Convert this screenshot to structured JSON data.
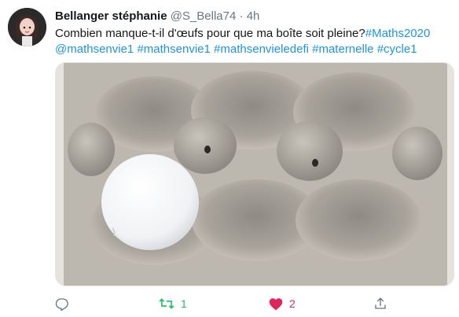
{
  "tweet": {
    "author_name": "Bellanger stéphanie",
    "handle": "@S_Bella74",
    "separator": "·",
    "time": "4h",
    "text_plain": "Combien manque-t-il d'œufs pour que ma boîte soit pleine?",
    "hashtags": [
      "#Maths2020",
      "@mathsenvie1",
      "#mathsenvie1",
      "#mathsenvieledefi",
      "#maternelle",
      "#cycle1"
    ]
  },
  "actions": {
    "reply_icon": "reply-icon",
    "retweet_icon": "retweet-icon",
    "retweet_count": "1",
    "like_icon": "heart-icon",
    "like_count": "2",
    "share_icon": "share-icon"
  },
  "colors": {
    "link": "#1b95e0",
    "retweet": "#17bf63",
    "like": "#e0245e",
    "muted": "#657786"
  }
}
